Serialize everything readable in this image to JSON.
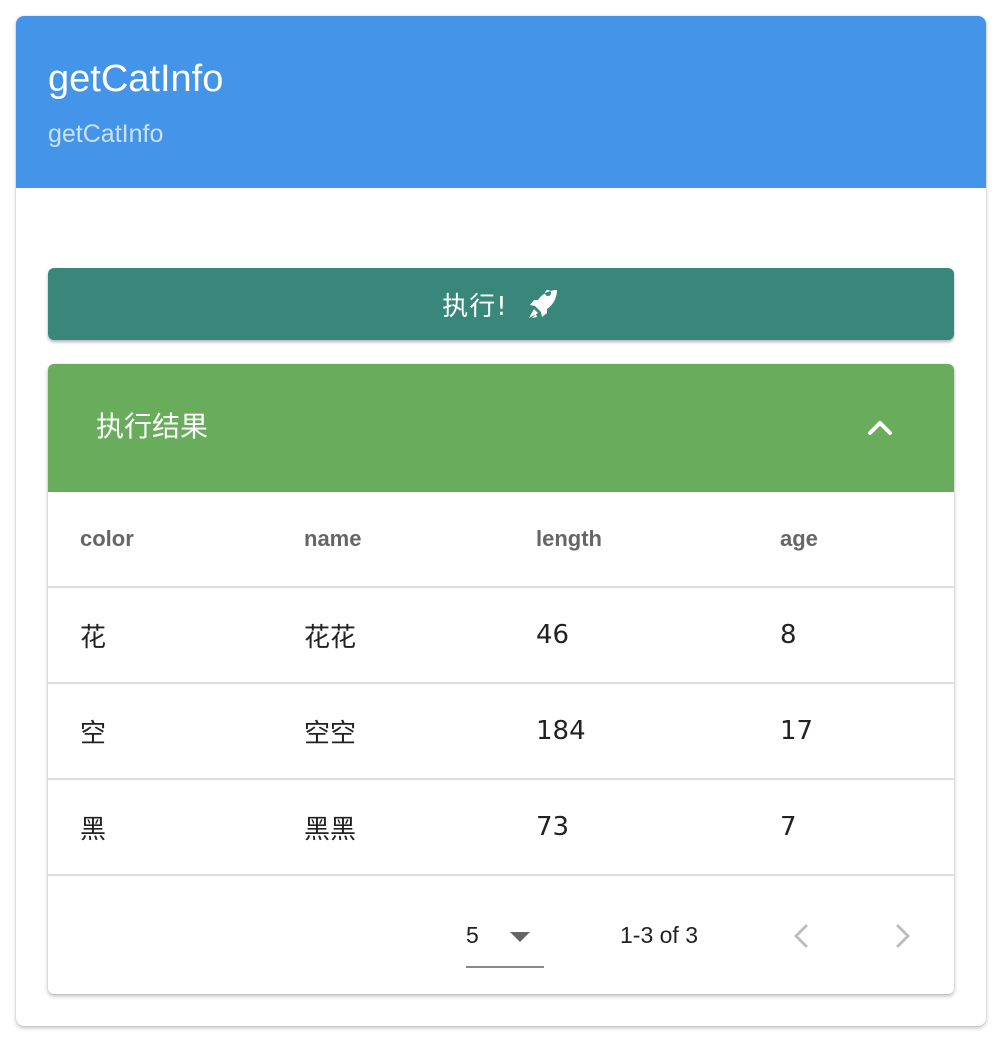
{
  "card": {
    "title": "getCatInfo",
    "subtitle": "getCatInfo"
  },
  "run_button": {
    "label": "执行!",
    "icon": "rocket-icon"
  },
  "result_panel": {
    "title": "执行结果",
    "expanded": true,
    "toggle_icon": "chevron-up-icon"
  },
  "table": {
    "columns": [
      "color",
      "name",
      "length",
      "age"
    ],
    "rows": [
      [
        "花",
        "花花",
        "46",
        "8"
      ],
      [
        "空",
        "空空",
        "184",
        "17"
      ],
      [
        "黑",
        "黑黑",
        "73",
        "7"
      ]
    ]
  },
  "pagination": {
    "rows_per_page": "5",
    "range_text": "1-3 of 3",
    "prev_icon": "chevron-left-icon",
    "next_icon": "chevron-right-icon"
  },
  "colors": {
    "header_bg": "#4495e9",
    "button_bg": "#38877a",
    "panel_header_bg": "#68ac5c"
  }
}
